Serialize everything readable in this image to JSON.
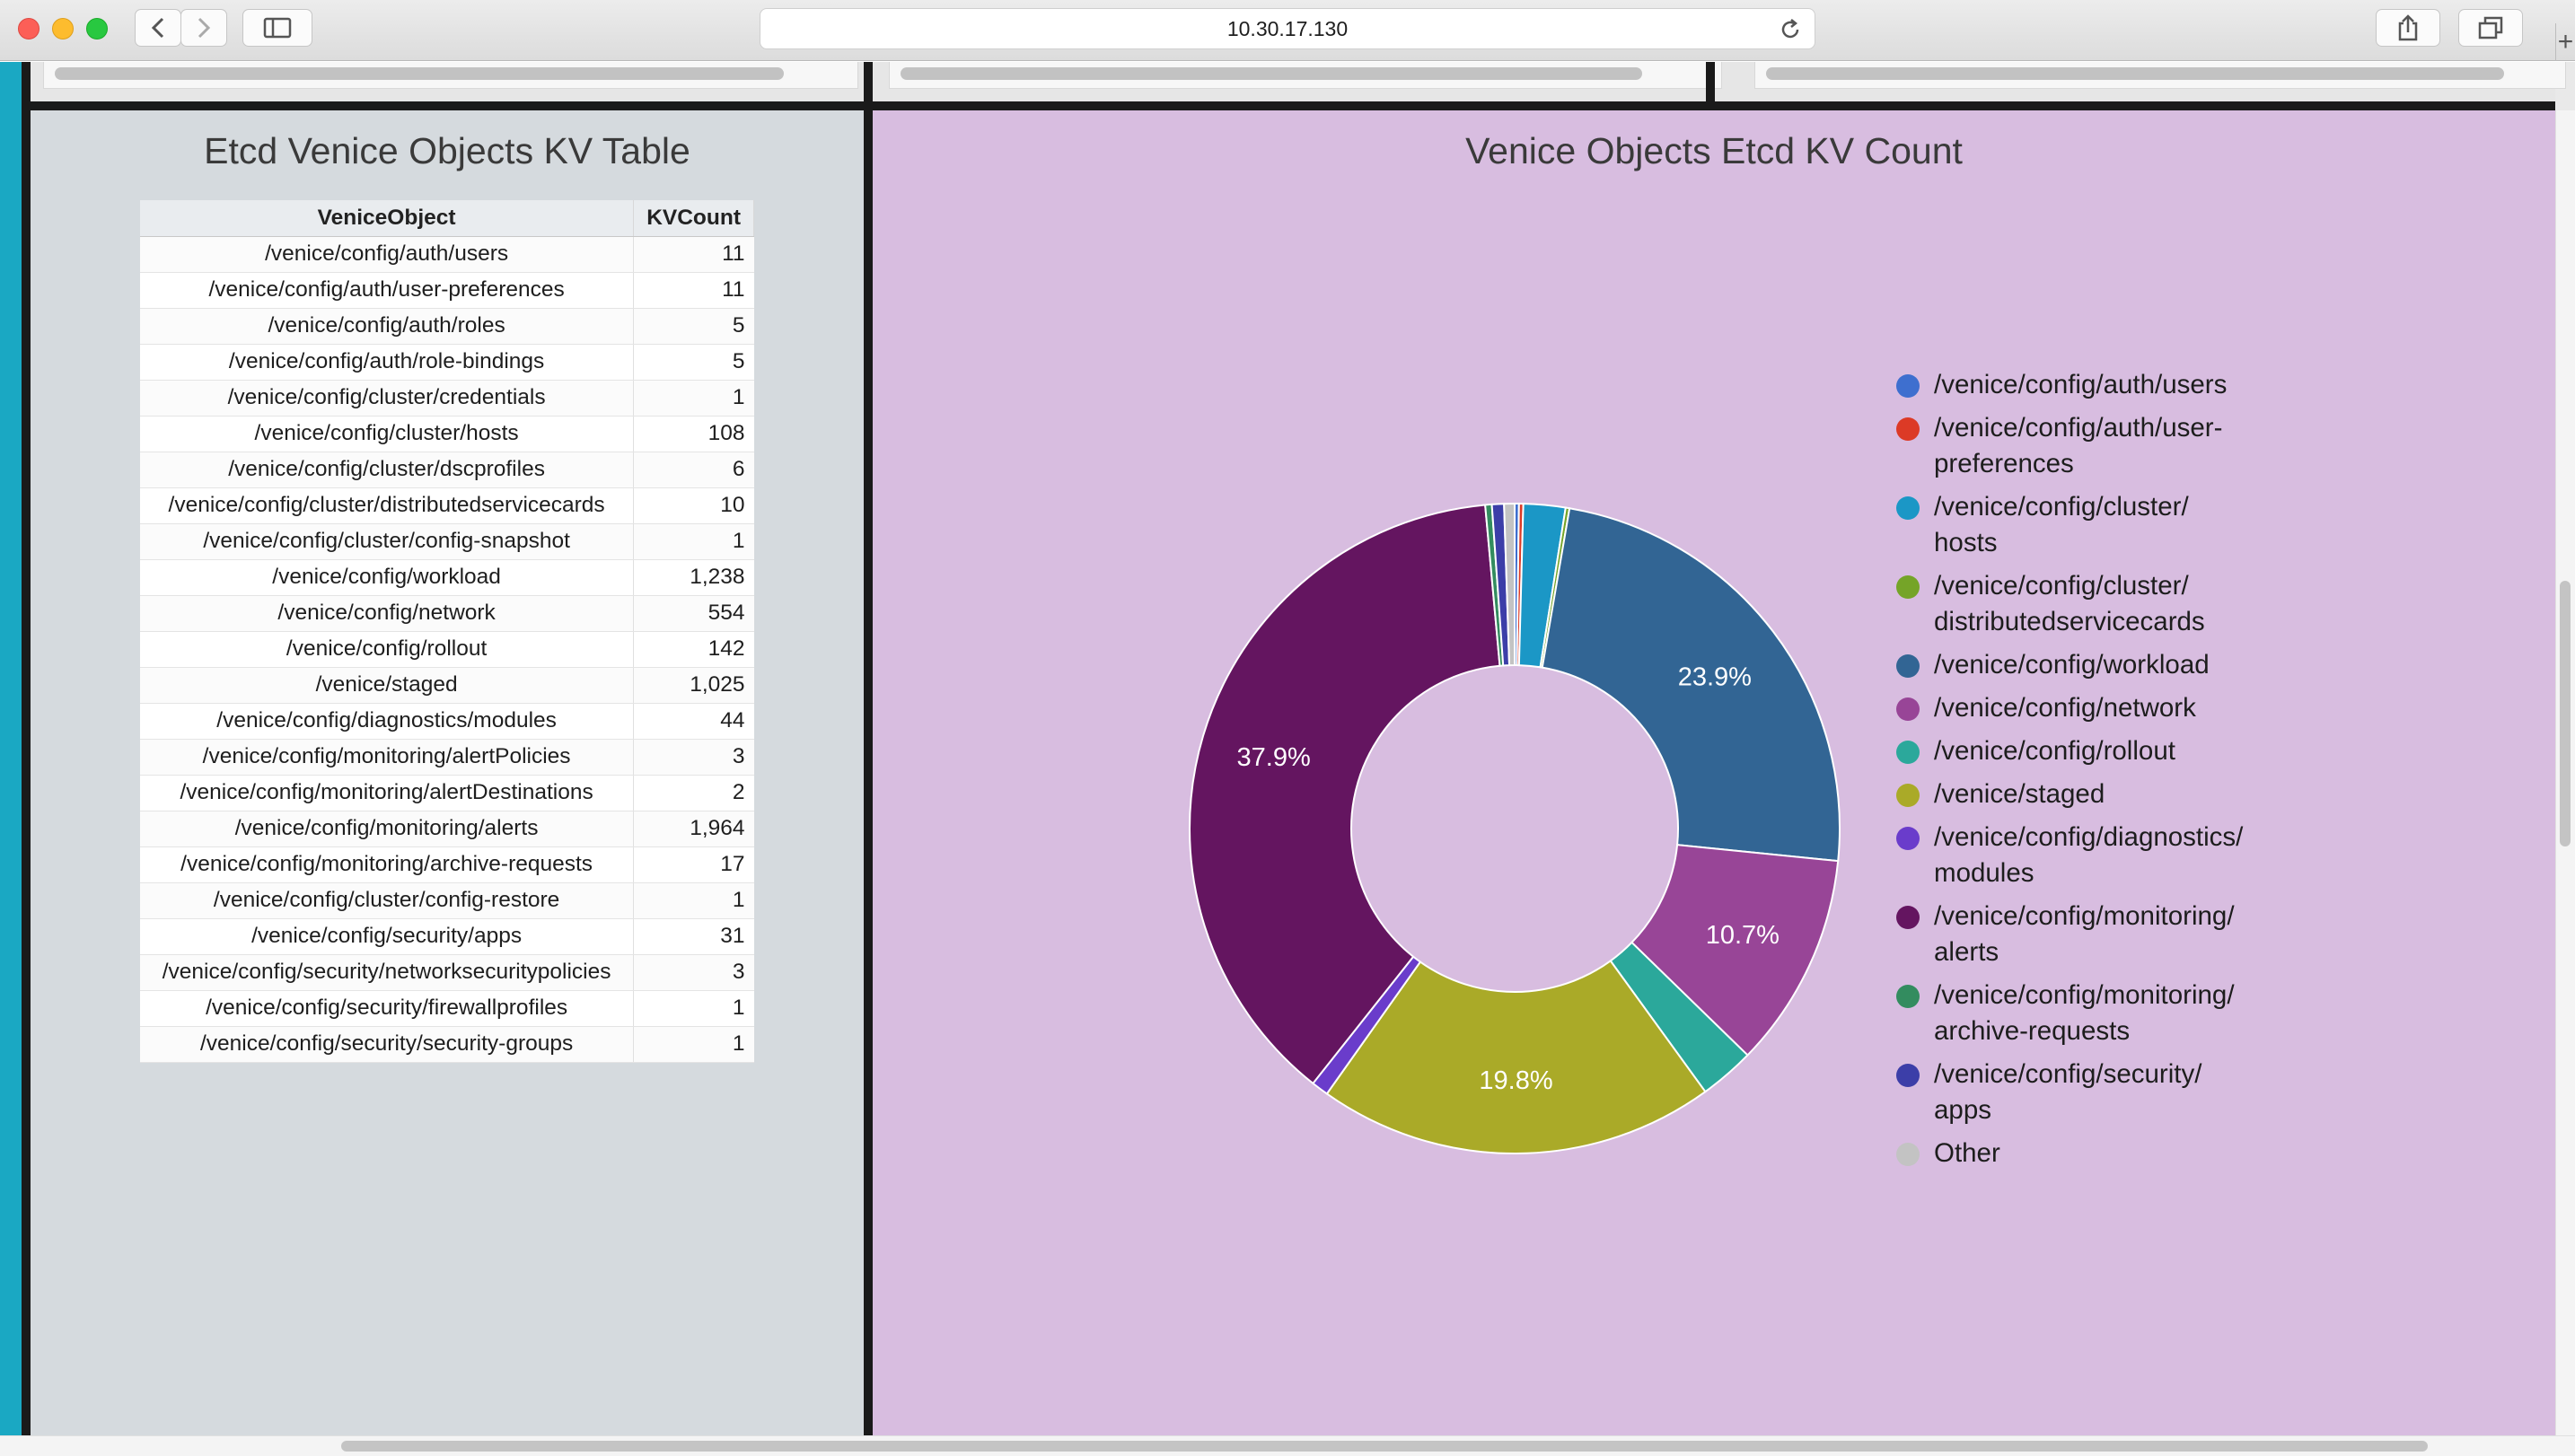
{
  "browser": {
    "url": "10.30.17.130",
    "icons": [
      "back-icon",
      "forward-icon",
      "sidebar-icon",
      "reload-icon",
      "share-icon",
      "tabs-icon",
      "plus-icon"
    ]
  },
  "table_panel": {
    "title": "Etcd Venice Objects KV Table",
    "columns": [
      "VeniceObject",
      "KVCount"
    ],
    "rows": [
      [
        "/venice/config/auth/users",
        "11"
      ],
      [
        "/venice/config/auth/user-preferences",
        "11"
      ],
      [
        "/venice/config/auth/roles",
        "5"
      ],
      [
        "/venice/config/auth/role-bindings",
        "5"
      ],
      [
        "/venice/config/cluster/credentials",
        "1"
      ],
      [
        "/venice/config/cluster/hosts",
        "108"
      ],
      [
        "/venice/config/cluster/dscprofiles",
        "6"
      ],
      [
        "/venice/config/cluster/distributedservicecards",
        "10"
      ],
      [
        "/venice/config/cluster/config-snapshot",
        "1"
      ],
      [
        "/venice/config/workload",
        "1,238"
      ],
      [
        "/venice/config/network",
        "554"
      ],
      [
        "/venice/config/rollout",
        "142"
      ],
      [
        "/venice/staged",
        "1,025"
      ],
      [
        "/venice/config/diagnostics/modules",
        "44"
      ],
      [
        "/venice/config/monitoring/alertPolicies",
        "3"
      ],
      [
        "/venice/config/monitoring/alertDestinations",
        "2"
      ],
      [
        "/venice/config/monitoring/alerts",
        "1,964"
      ],
      [
        "/venice/config/monitoring/archive-requests",
        "17"
      ],
      [
        "/venice/config/cluster/config-restore",
        "1"
      ],
      [
        "/venice/config/security/apps",
        "31"
      ],
      [
        "/venice/config/security/networksecuritypolicies",
        "3"
      ],
      [
        "/venice/config/security/firewallprofiles",
        "1"
      ],
      [
        "/venice/config/security/security-groups",
        "1"
      ]
    ]
  },
  "chart_panel": {
    "title": "Venice Objects Etcd KV Count"
  },
  "chart_data": {
    "type": "pie",
    "donut": true,
    "title": "Venice Objects Etcd KV Count",
    "legend_position": "right",
    "slices": [
      {
        "label": "/venice/config/auth/users",
        "value": 11,
        "color": "#3e6fcf"
      },
      {
        "label": "/venice/config/auth/user-preferences",
        "value": 11,
        "color": "#dc3a26"
      },
      {
        "label": "/venice/config/cluster/hosts",
        "value": 108,
        "color": "#1b97c6"
      },
      {
        "label": "/venice/config/cluster/distributedservicecards",
        "value": 10,
        "color": "#75a428"
      },
      {
        "label": "/venice/config/workload",
        "value": 1238,
        "color": "#326594",
        "display": "23.9%"
      },
      {
        "label": "/venice/config/network",
        "value": 554,
        "color": "#984597",
        "display": "10.7%"
      },
      {
        "label": "/venice/config/rollout",
        "value": 142,
        "color": "#2ba89b"
      },
      {
        "label": "/venice/staged",
        "value": 1025,
        "color": "#aaaa28",
        "display": "19.8%"
      },
      {
        "label": "/venice/config/diagnostics/modules",
        "value": 44,
        "color": "#6a3ccb"
      },
      {
        "label": "/venice/config/monitoring/alerts",
        "value": 1964,
        "color": "#641560",
        "display": "37.9%"
      },
      {
        "label": "/venice/config/monitoring/archive-requests",
        "value": 17,
        "color": "#338c5f"
      },
      {
        "label": "/venice/config/security/apps",
        "value": 31,
        "color": "#3c3ea8"
      },
      {
        "label": "Other",
        "value": 27,
        "color": "#c3c3c3"
      }
    ],
    "legend": [
      {
        "label": [
          "/venice/config/auth/users"
        ],
        "color": "#3e6fcf"
      },
      {
        "label": [
          "/venice/config/auth/user-",
          "preferences"
        ],
        "color": "#dc3a26"
      },
      {
        "label": [
          "/venice/config/cluster/",
          "hosts"
        ],
        "color": "#1b97c6"
      },
      {
        "label": [
          "/venice/config/cluster/",
          "distributedservicecards"
        ],
        "color": "#75a428"
      },
      {
        "label": [
          "/venice/config/workload"
        ],
        "color": "#326594"
      },
      {
        "label": [
          "/venice/config/network"
        ],
        "color": "#984597"
      },
      {
        "label": [
          "/venice/config/rollout"
        ],
        "color": "#2ba89b"
      },
      {
        "label": [
          "/venice/staged"
        ],
        "color": "#aaaa28"
      },
      {
        "label": [
          "/venice/config/diagnostics/",
          "modules"
        ],
        "color": "#6a3ccb"
      },
      {
        "label": [
          "/venice/config/monitoring/",
          "alerts"
        ],
        "color": "#641560"
      },
      {
        "label": [
          "/venice/config/monitoring/",
          "archive-requests"
        ],
        "color": "#338c5f"
      },
      {
        "label": [
          "/venice/config/security/",
          "apps"
        ],
        "color": "#3c3ea8"
      },
      {
        "label": [
          "Other"
        ],
        "color": "#c3c3c3"
      }
    ]
  },
  "colors": {
    "left_panel_bg": "#d5dade",
    "right_panel_bg": "#d8bde0",
    "accent_teal": "#1aa8c3",
    "divider": "#1a1a1a"
  }
}
